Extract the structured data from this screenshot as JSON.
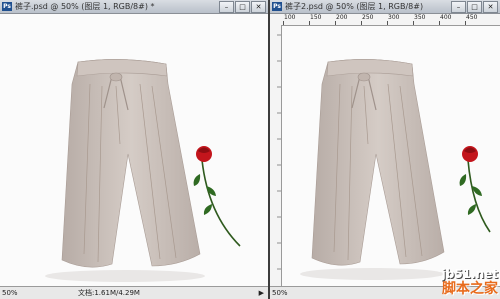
{
  "windows": {
    "left": {
      "title": "裤子.psd @ 50% (图层 1, RGB/8#) *",
      "zoom": "50%",
      "doc_info": "文档:1.61M/4.29M"
    },
    "right": {
      "title": "裤子2.psd @ 50% (图层 1, RGB/8#)",
      "zoom": "50%",
      "ruler_labels": [
        "100",
        "150",
        "200",
        "250",
        "300",
        "350",
        "400",
        "450"
      ]
    }
  },
  "window_buttons": {
    "minimize": "–",
    "maximize": "□",
    "close": "✕"
  },
  "watermark": {
    "url": "jb51.net",
    "site_name": "脚本之家"
  },
  "colors": {
    "titlebar": "#c9ced6",
    "canvas": "#fbfbfb",
    "pants": "#c8bdb7",
    "rose": "#c3151c",
    "watermark_orange": "#e86b1c"
  },
  "icons": {
    "app": "photoshop-icon",
    "nav": "triangle-right-icon"
  }
}
